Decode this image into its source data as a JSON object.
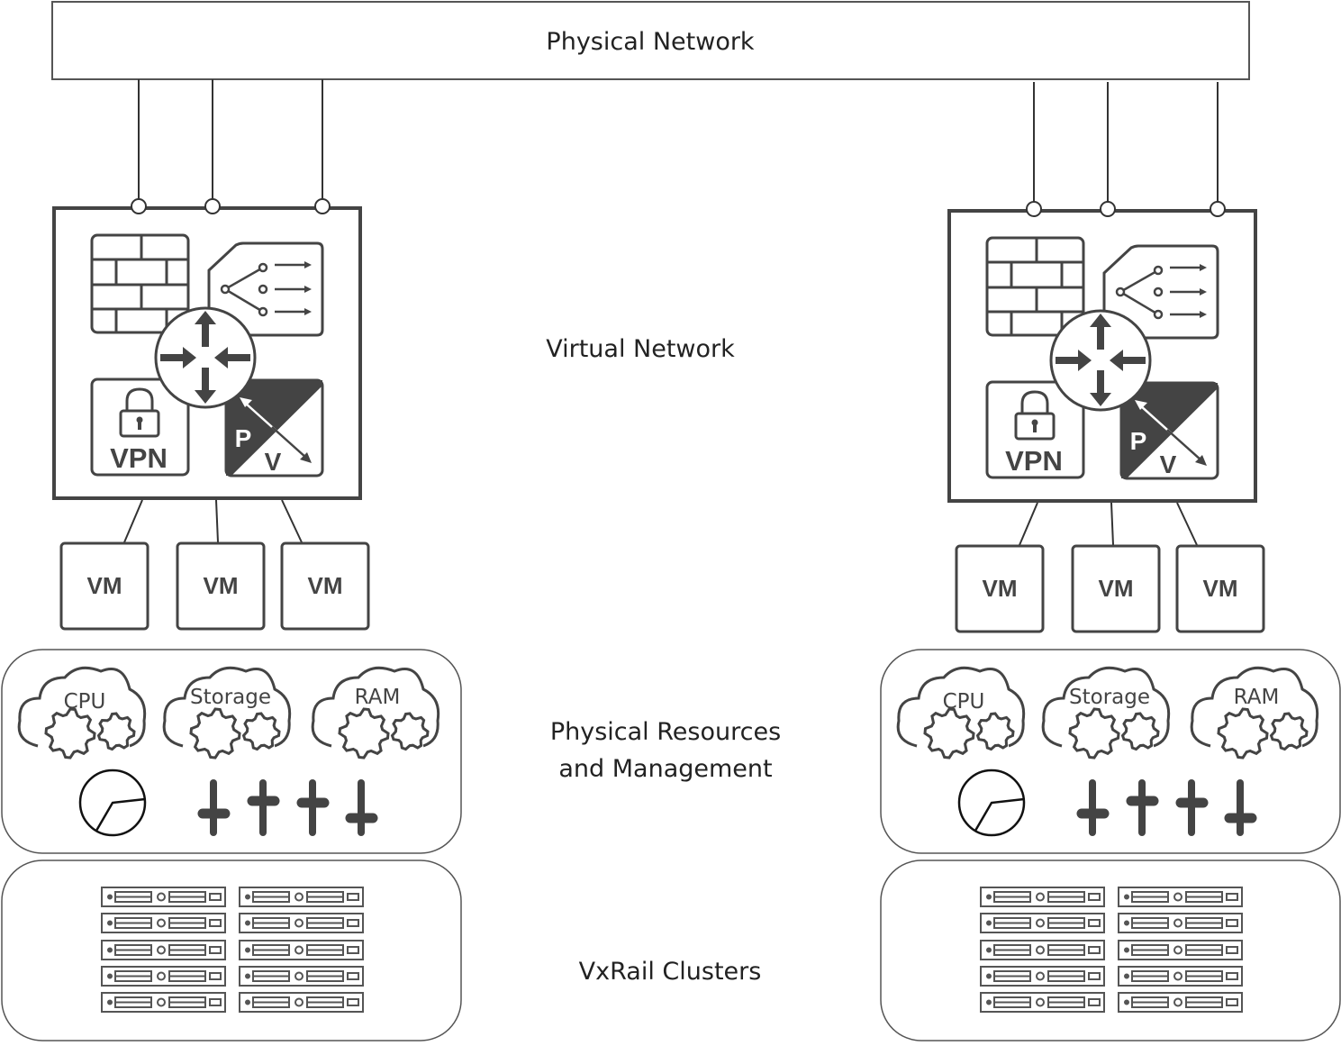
{
  "labels": {
    "physical_network": "Physical Network",
    "virtual_network": "Virtual Network",
    "physical_resources_line1": "Physical Resources",
    "physical_resources_line2": "and Management",
    "vxrail_clusters": "VxRail Clusters"
  },
  "icons": {
    "vpn": "VPN",
    "p": "P",
    "v": "V",
    "vm": "VM",
    "cpu": "CPU",
    "storage": "Storage",
    "ram": "RAM"
  },
  "sites": [
    "left",
    "right"
  ],
  "colors": {
    "stroke": "#444444",
    "text": "#222222",
    "background": "#ffffff"
  }
}
